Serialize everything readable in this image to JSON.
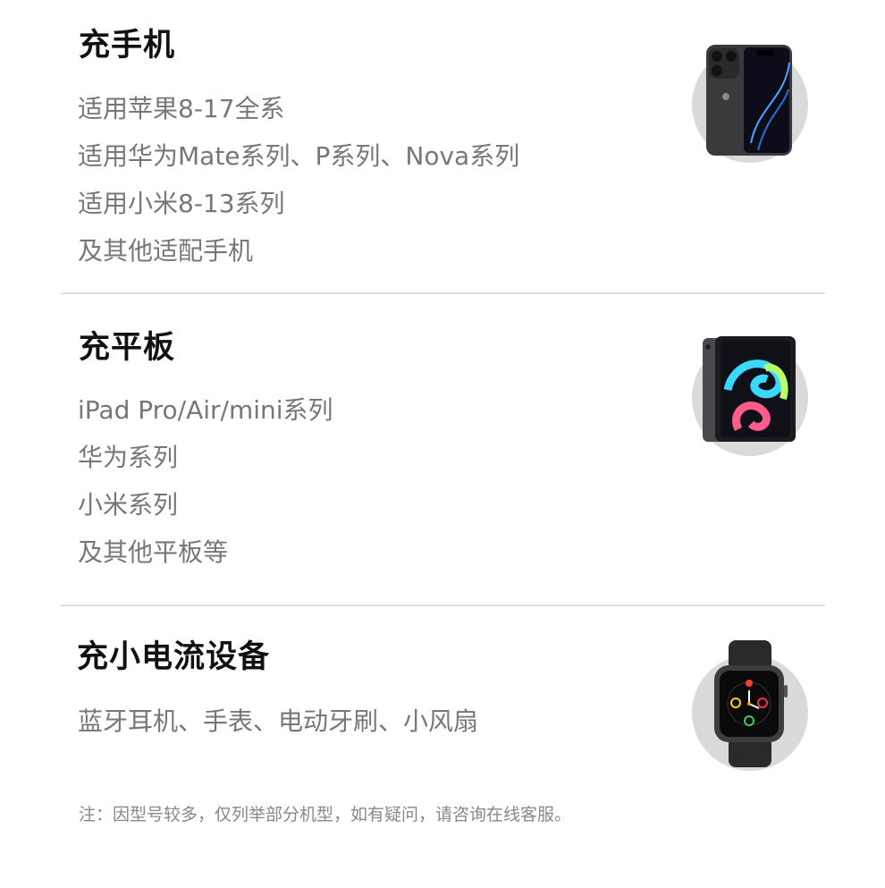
{
  "sections": [
    {
      "title": "充手机",
      "lines": [
        "适用苹果8-17全系",
        "适用华为Mate系列、P系列、Nova系列",
        "适用小米8-13系列",
        "及其他适配手机"
      ],
      "icon": "smartphone-icon"
    },
    {
      "title": "充平板",
      "lines": [
        "iPad Pro/Air/mini系列",
        "华为系列",
        "小米系列",
        "及其他平板等"
      ],
      "icon": "tablet-icon"
    },
    {
      "title": "充小电流设备",
      "lines": [
        "蓝牙耳机、手表、电动牙刷、小风扇"
      ],
      "icon": "smartwatch-icon"
    }
  ],
  "note": "注：因型号较多，仅列举部分机型，如有疑问，请咨询在线客服。",
  "colors": {
    "title": "#111111",
    "body": "#777777",
    "divider": "#dedede",
    "thumb_bg": "#dadada"
  }
}
